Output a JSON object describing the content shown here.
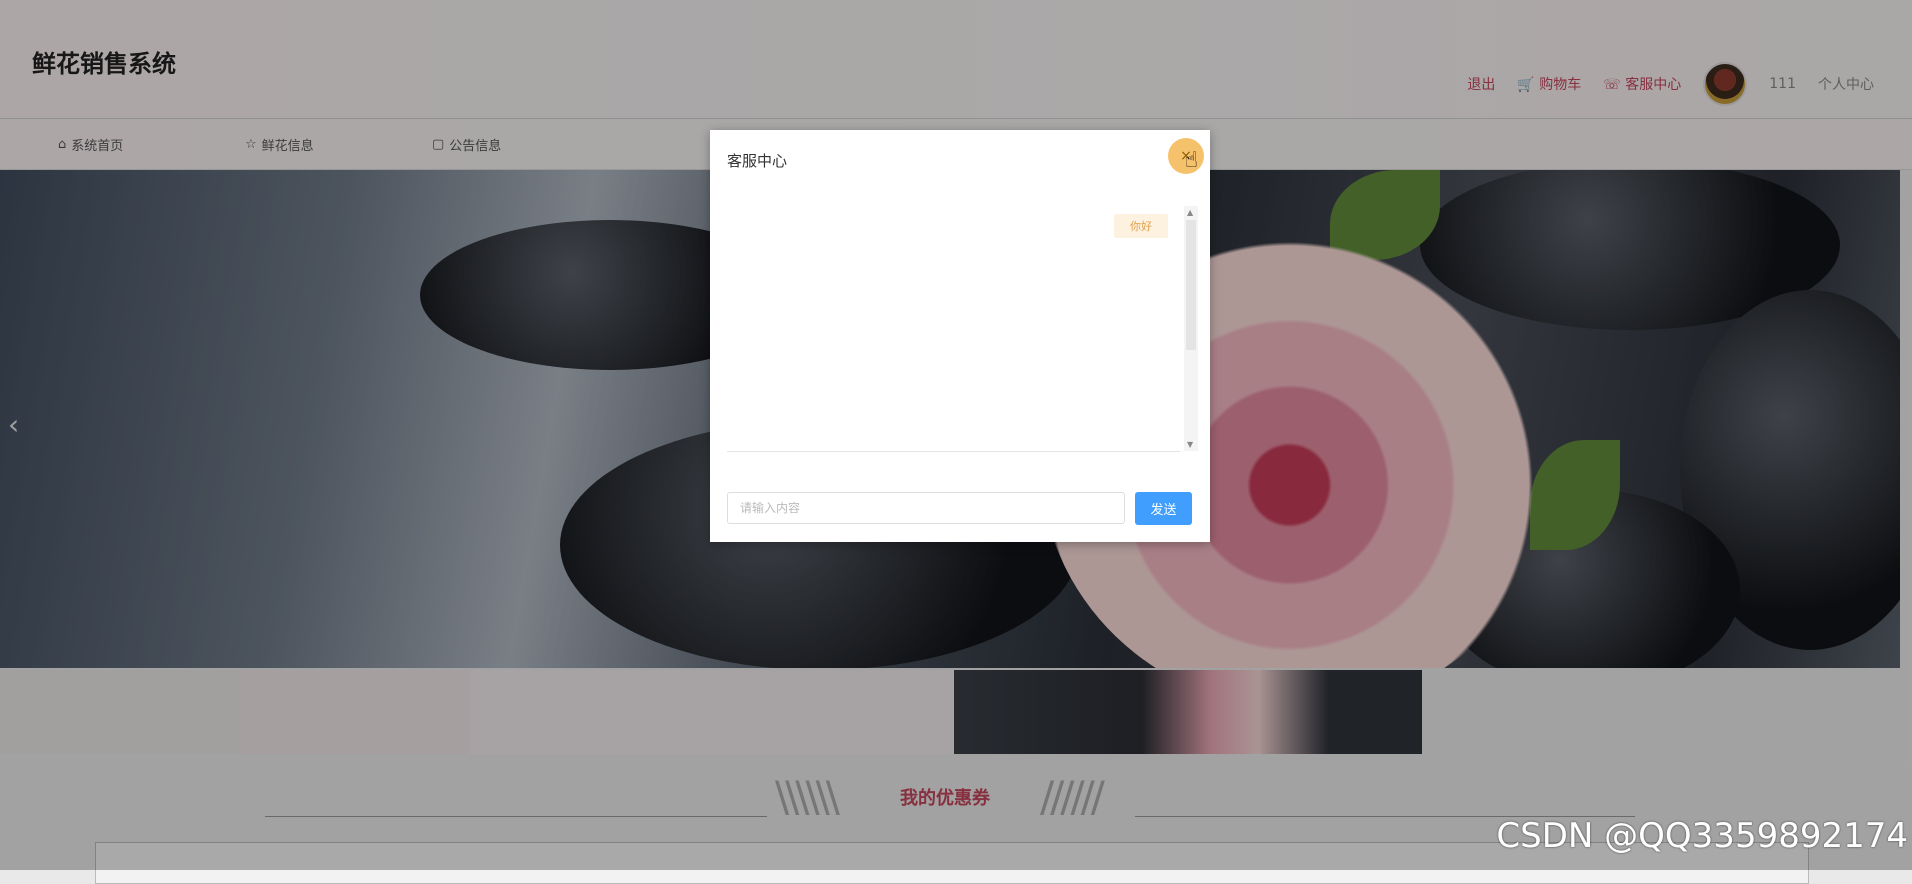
{
  "header": {
    "site_title": "鲜花销售系统",
    "user_nav": {
      "logout": "退出",
      "cart": "购物车",
      "service": "客服中心",
      "username": "111",
      "profile": "个人中心"
    }
  },
  "navbar": {
    "items": [
      {
        "label": "系统首页",
        "icon": "home-icon"
      },
      {
        "label": "鲜花信息",
        "icon": "star-icon"
      },
      {
        "label": "公告信息",
        "icon": "bulletin-icon"
      }
    ]
  },
  "section": {
    "coupon_title": "我的优惠券"
  },
  "dialog": {
    "title": "客服中心",
    "greeting_bubble": "你好",
    "input_placeholder": "请输入内容",
    "send_label": "发送"
  },
  "watermark": "CSDN @QQ3359892174",
  "colors": {
    "accent": "#c2455b",
    "primary_button": "#409eff",
    "close_button": "#f5c26b"
  }
}
